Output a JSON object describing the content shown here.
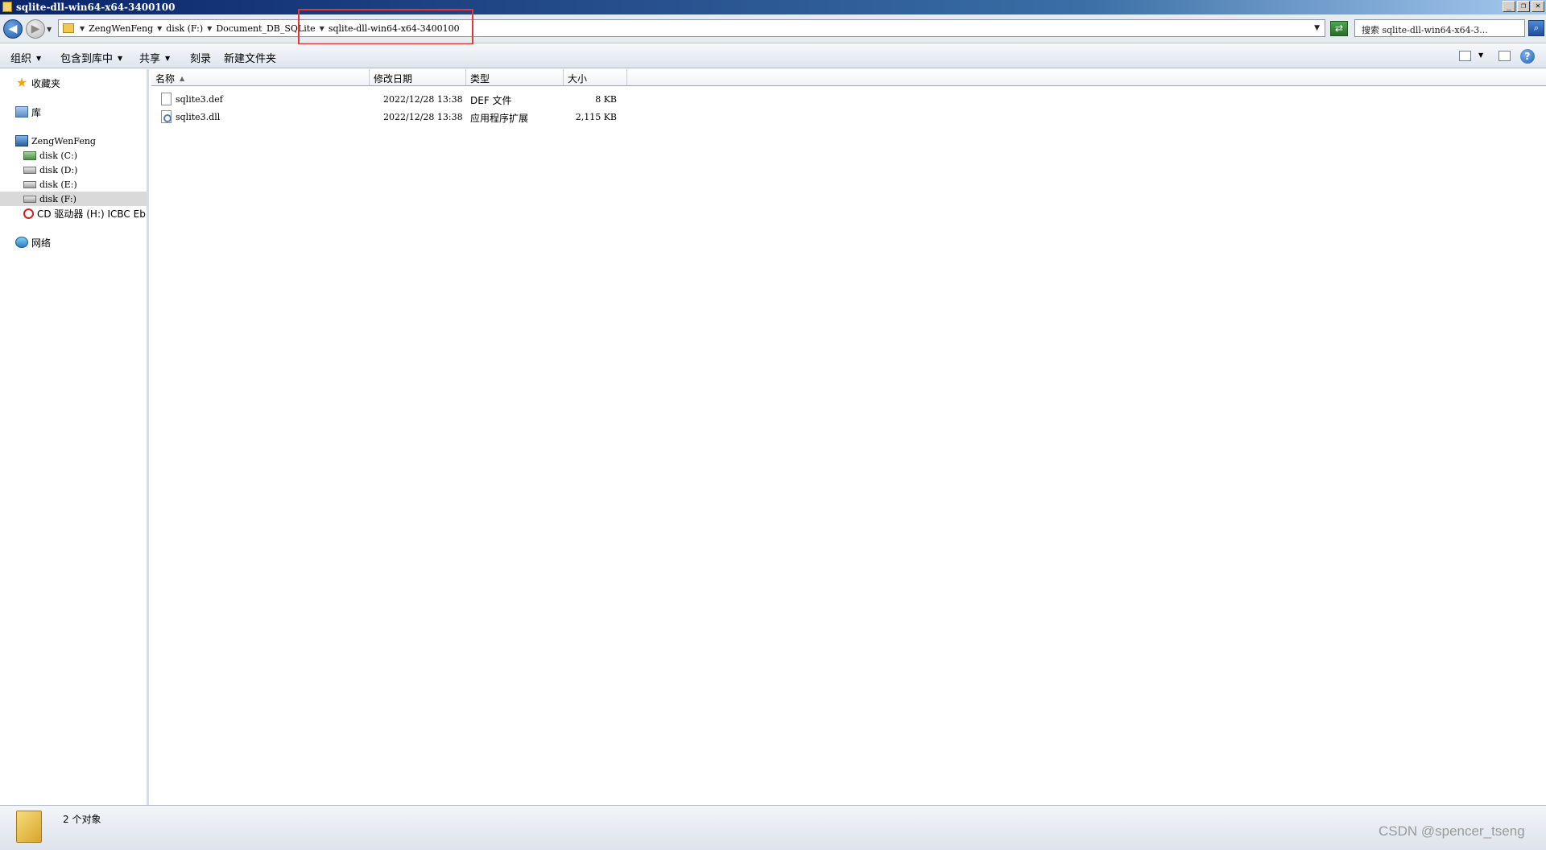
{
  "window": {
    "title": "sqlite-dll-win64-x64-3400100",
    "minimize": "_",
    "restore": "❐",
    "close": "✕"
  },
  "address": {
    "breadcrumbs": [
      "ZengWenFeng",
      "disk (F:)",
      "Document_DB_SQLite",
      "sqlite-dll-win64-x64-3400100"
    ],
    "search_placeholder": "搜索 sqlite-dll-win64-x64-3..."
  },
  "toolbar": {
    "organize": "组织",
    "include_in_library": "包含到库中",
    "share": "共享",
    "burn": "刻录",
    "new_folder": "新建文件夹"
  },
  "nav": {
    "favorites": "收藏夹",
    "libraries": "库",
    "computer": "ZengWenFeng",
    "drives": [
      "disk (C:)",
      "disk (D:)",
      "disk (E:)",
      "disk (F:)"
    ],
    "cd_drive": "CD 驱动器 (H:) ICBC Eb",
    "network": "网络"
  },
  "columns": {
    "name": "名称",
    "date_modified": "修改日期",
    "type": "类型",
    "size": "大小"
  },
  "files": [
    {
      "name": "sqlite3.def",
      "date": "2022/12/28 13:38",
      "type": "DEF 文件",
      "size": "8 KB",
      "icon": "text-file-icon"
    },
    {
      "name": "sqlite3.dll",
      "date": "2022/12/28 13:38",
      "type": "应用程序扩展",
      "size": "2,115 KB",
      "icon": "dll-file-icon"
    }
  ],
  "status": {
    "item_count": "2 个对象"
  },
  "watermark": "CSDN @spencer_tseng",
  "colors": {
    "titlebar": "#0a246a",
    "highlight_box": "#e5353a",
    "selected_nav": "#d9d9d9"
  }
}
